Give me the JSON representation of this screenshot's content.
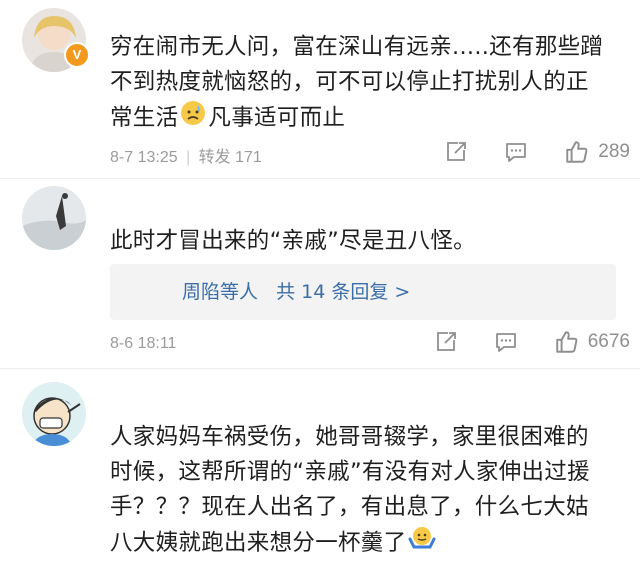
{
  "comments": [
    {
      "text_lines": [
        "穷在闹市无人问，富在深山有远亲.....还有那些蹭",
        "不到热度就恼怒的，可不可以停止打扰别人的正",
        "常生活"
      ],
      "emoji_icon": "sad-face-emoji",
      "text_tail": "凡事适可而止",
      "date": "8-7 13:25",
      "repost_label": "转发 171",
      "like_count": "289",
      "verified_badge": "V"
    },
    {
      "text_lines": [
        "此时才冒出来的“亲戚”尽是丑八怪。"
      ],
      "replies_names": "周陷等人",
      "replies_count": "共 14 条回复 >",
      "date": "8-6 18:11",
      "like_count": "6676"
    },
    {
      "text_lines": [
        "人家妈妈车祸受伤，她哥哥辍学，家里很困难的",
        "时候，这帮所谓的“亲戚”有没有对人家伸出过援",
        "手？？？现在人出名了，有出息了，什么七大姑",
        "八大姨就跑出来想分一杯羹了"
      ],
      "emoji_icon": "shrug-emoji"
    }
  ],
  "colors": {
    "link_blue": "#3b6ea8",
    "meta_gray": "#9b9b9b",
    "reply_bg": "#f3f3f3",
    "badge_orange": "#f39a1e"
  }
}
